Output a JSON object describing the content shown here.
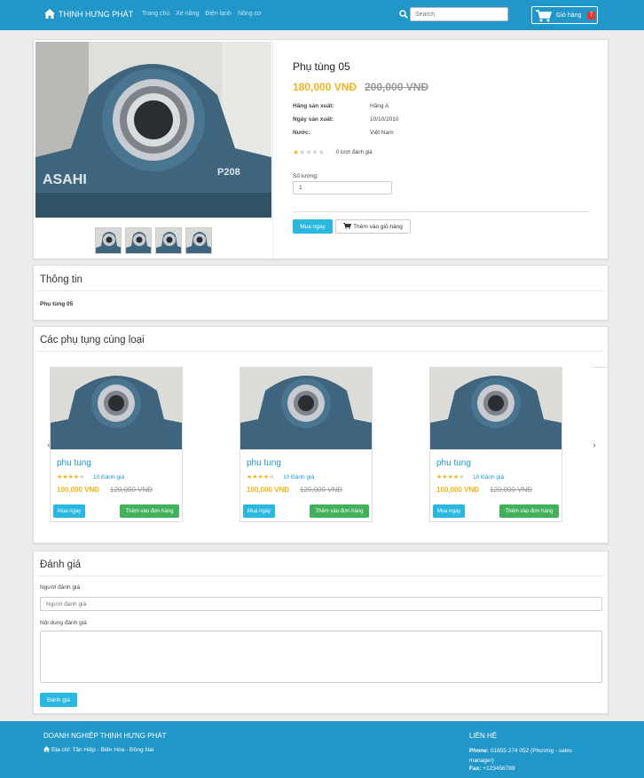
{
  "nav": {
    "brand": "THỊNH HƯNG PHÁT",
    "menu": [
      "Trang chủ",
      "Xe nâng",
      "Điện lạnh",
      "Nông cơ"
    ],
    "search_placeholder": "Search",
    "cart_label": "Giỏ hàng",
    "cart_count": "7"
  },
  "product": {
    "title": "Phụ tùng 05",
    "price": "180,000 VNĐ",
    "old_price": "200,000 VNĐ",
    "specs": [
      {
        "label": "Hãng sản xuất:",
        "value": "Hãng A"
      },
      {
        "label": "Ngày sản xuất:",
        "value": "10/10/2010"
      },
      {
        "label": "Nước:",
        "value": "Việt Nam"
      }
    ],
    "rating_stars": 1,
    "rating_text": "0 lượt đánh giá",
    "quantity_label": "Số lượng:",
    "quantity_value": "1",
    "buy_label": "Mua ngay",
    "add_label": "Thêm vào giỏ hàng",
    "image_brand": "ASAHI",
    "image_model": "P208"
  },
  "info": {
    "title": "Thông tin",
    "text": "Phụ tùng 05"
  },
  "related": {
    "title": "Các phụ tụng cùng loại",
    "items": [
      {
        "name": "phu tung",
        "stars": 4,
        "count": "10 Đánh giá",
        "price": "100,000 VNĐ",
        "old_price": "120,000 VNĐ",
        "buy": "Mua ngay",
        "add": "Thêm vào đơn hàng"
      },
      {
        "name": "phu tung",
        "stars": 4,
        "count": "10 Đánh giá",
        "price": "100,000 VNĐ",
        "old_price": "120,000 VNĐ",
        "buy": "Mua ngay",
        "add": "Thêm vào đơn hàng"
      },
      {
        "name": "phu tung",
        "stars": 4,
        "count": "10 Đánh giá",
        "price": "100,000 VNĐ",
        "old_price": "120,000 VNĐ",
        "buy": "Mua ngay",
        "add": "Thêm vào đơn hàng"
      }
    ]
  },
  "review": {
    "title": "Đánh giá",
    "reviewer_label": "Người đánh giá",
    "reviewer_placeholder": "Người đánh giá",
    "content_label": "Nội dung đánh giá",
    "submit": "Đánh giá"
  },
  "footer": {
    "company": "DOANH NGHIỆP THỊNH HƯNG PHÁT",
    "address": "Địa chỉ: Tân Hiệp - Biên Hòa - Đồng Nai",
    "contact_title": "LIÊN HỆ",
    "phone_label": "Phone:",
    "phone_value": "01655 274 052 (Phương - sales manager)",
    "fax_label": "Fax:",
    "fax_value": "+123456789"
  },
  "colors": {
    "primary": "#2196c9",
    "price": "#f2b41e",
    "button": "#2ab7e0",
    "green": "#43b05c"
  }
}
